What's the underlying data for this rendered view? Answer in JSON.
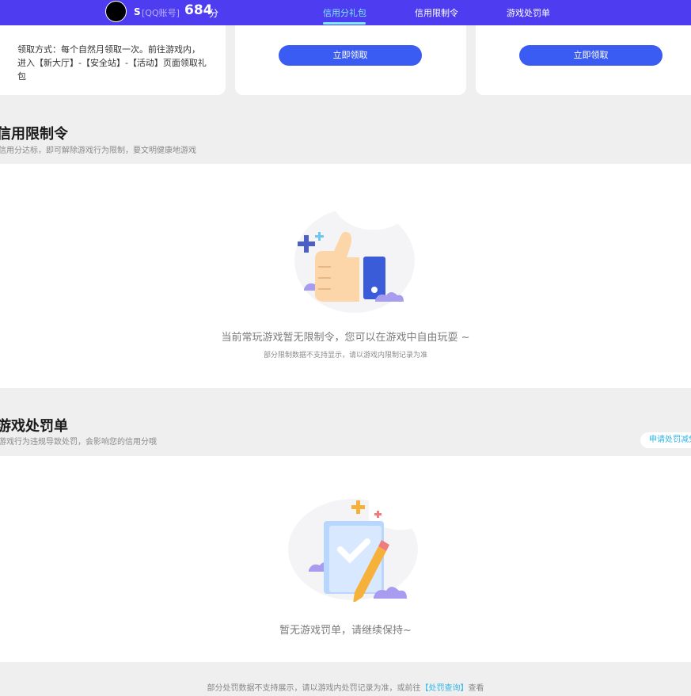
{
  "header": {
    "username": "S",
    "account_type": "[QQ账号]",
    "score": "684",
    "score_unit": "分",
    "tabs": [
      "信用分礼包",
      "信用限制令",
      "游戏处罚单"
    ]
  },
  "gift_cards": {
    "description": "领取方式：每个自然月领取一次。前往游戏内，进入【新大厅】-【安全站】-【活动】页面领取礼包",
    "claim_label": "立即领取"
  },
  "restriction": {
    "title": "信用限制令",
    "subtitle": "信用分达标，即可解除游戏行为限制，要文明健康地游戏",
    "empty_text": "当前常玩游戏暂无限制令，您可以在游戏中自由玩耍 ~",
    "note": "部分限制数据不支持显示，请以游戏内限制记录为准"
  },
  "penalty": {
    "title": "游戏处罚单",
    "subtitle": "游戏行为违规导致处罚，会影响您的信用分哦",
    "apply_label": "申请处罚减免",
    "empty_text": "暂无游戏罚单，请继续保持~"
  },
  "footer": {
    "text_before": "部分处罚数据不支持展示，请以游戏内处罚记录为准，或前往",
    "link_label": "【处罚查询】",
    "text_after": "查看"
  },
  "icons": [
    "thumbs-up-illustration",
    "checklist-pencil-illustration"
  ],
  "colors": {
    "topbar": "#4e3df0",
    "accent": "#3b5cf2",
    "link": "#2fb6e8"
  }
}
